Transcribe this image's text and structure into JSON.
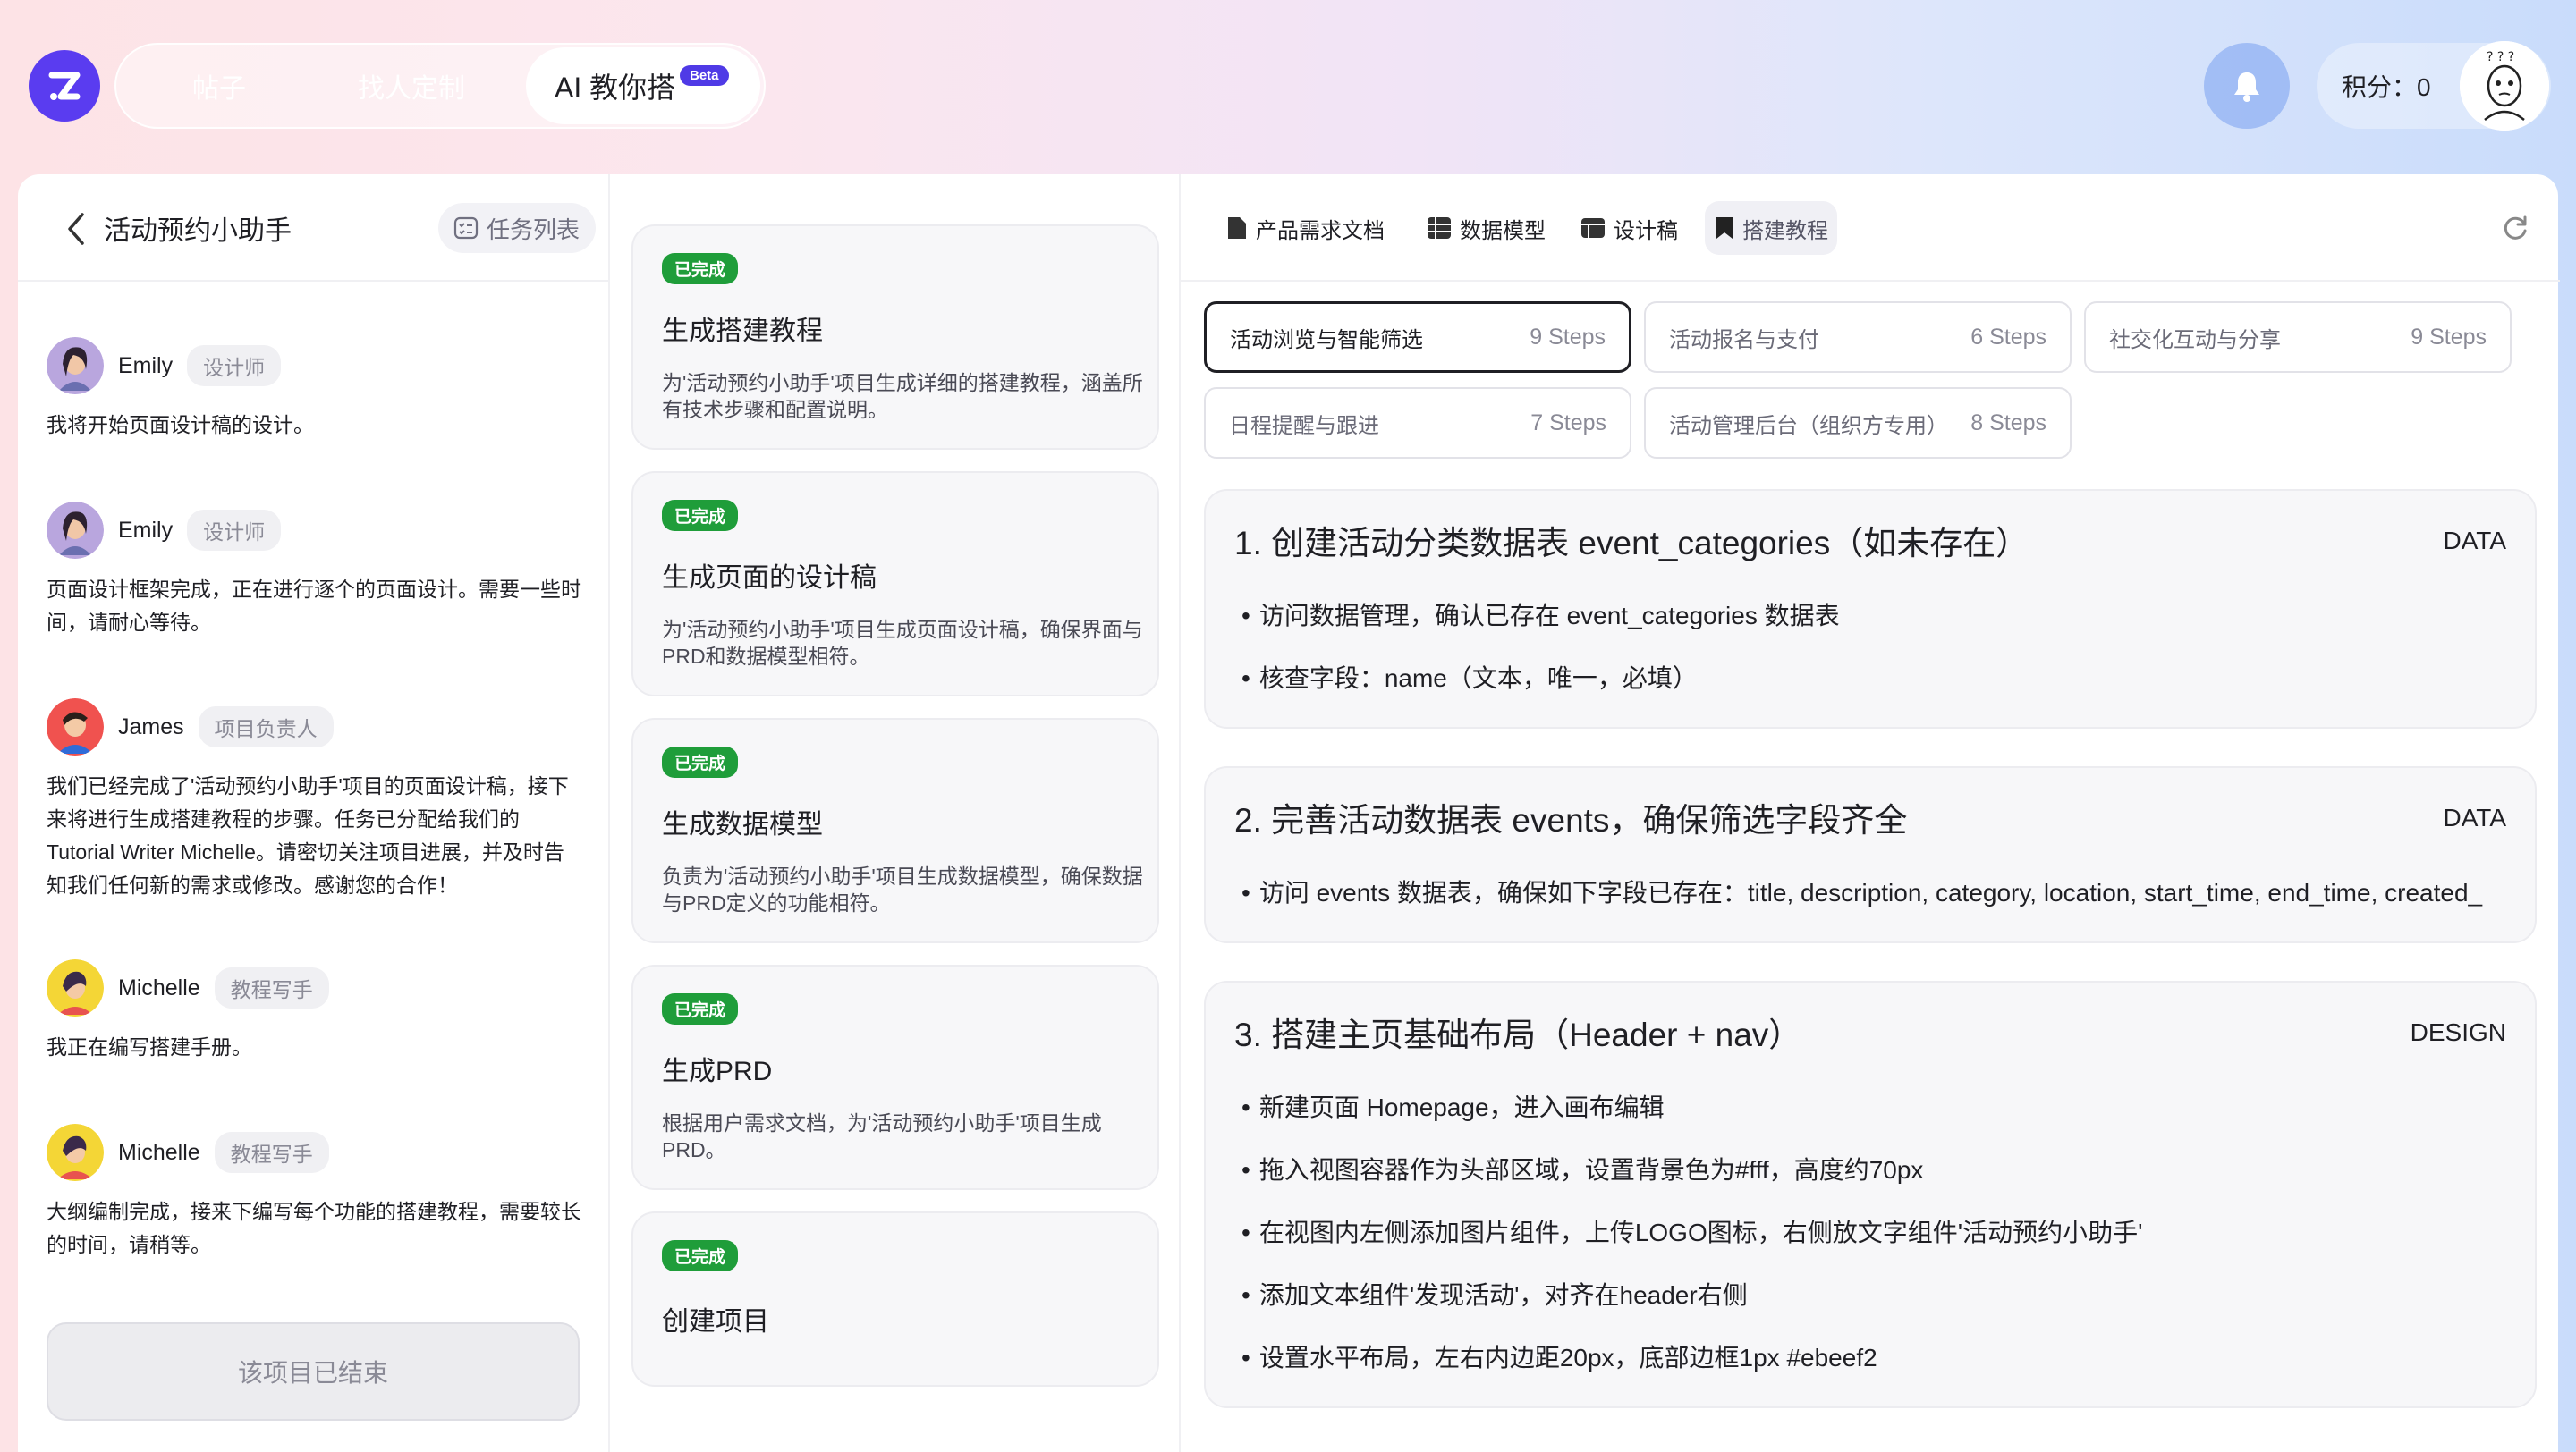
{
  "nav": {
    "tabs": [
      "帖子",
      "找人定制"
    ],
    "active_tab": "AI 教你搭",
    "beta": "Beta",
    "score_label": "积分：0"
  },
  "left": {
    "title": "活动预约小助手",
    "task_list": "任务列表",
    "messages": [
      {
        "name": "Emily",
        "role": "设计师",
        "text": "我将开始页面设计稿的设计。"
      },
      {
        "name": "Emily",
        "role": "设计师",
        "text": "页面设计框架完成，正在进行逐个的页面设计。需要一些时间，请耐心等待。"
      },
      {
        "name": "James",
        "role": "项目负责人",
        "text": "我们已经完成了'活动预约小助手'项目的页面设计稿，接下来将进行生成搭建教程的步骤。任务已分配给我们的Tutorial Writer Michelle。请密切关注项目进展，并及时告知我们任何新的需求或修改。感谢您的合作！"
      },
      {
        "name": "Michelle",
        "role": "教程写手",
        "text": "我正在编写搭建手册。"
      },
      {
        "name": "Michelle",
        "role": "教程写手",
        "text": "大纲编制完成，接来下编写每个功能的搭建教程，需要较长的时间，请稍等。"
      }
    ],
    "ended": "该项目已结束"
  },
  "mid": {
    "cards": [
      {
        "badge": "已完成",
        "title": "生成搭建教程",
        "desc": "为'活动预约小助手'项目生成详细的搭建教程，涵盖所有技术步骤和配置说明。"
      },
      {
        "badge": "已完成",
        "title": "生成页面的设计稿",
        "desc": "为'活动预约小助手'项目生成页面设计稿，确保界面与PRD和数据模型相符。"
      },
      {
        "badge": "已完成",
        "title": "生成数据模型",
        "desc": "负责为'活动预约小助手'项目生成数据模型，确保数据与PRD定义的功能相符。"
      },
      {
        "badge": "已完成",
        "title": "生成PRD",
        "desc": "根据用户需求文档，为'活动预约小助手'项目生成PRD。"
      },
      {
        "badge": "已完成",
        "title": "创建项目",
        "desc": ""
      }
    ]
  },
  "right": {
    "tabs": [
      "产品需求文档",
      "数据模型",
      "设计稿",
      "搭建教程"
    ],
    "chips": [
      {
        "label": "活动浏览与智能筛选",
        "steps": "9 Steps"
      },
      {
        "label": "活动报名与支付",
        "steps": "6 Steps"
      },
      {
        "label": "社交化互动与分享",
        "steps": "9 Steps"
      },
      {
        "label": "日程提醒与跟进",
        "steps": "7 Steps"
      },
      {
        "label": "活动管理后台（组织方专用）",
        "steps": "8 Steps"
      }
    ],
    "steps": [
      {
        "title": "1. 创建活动分类数据表 event_categories（如未存在）",
        "type": "DATA",
        "items": [
          "访问数据管理，确认已存在 event_categories 数据表",
          "核查字段：name（文本，唯一，必填）"
        ]
      },
      {
        "title": "2. 完善活动数据表 events，确保筛选字段齐全",
        "type": "DATA",
        "items": [
          "访问 events 数据表，确保如下字段已存在：title, description, category, location, start_time, end_time, created_"
        ]
      },
      {
        "title": "3. 搭建主页基础布局（Header + nav）",
        "type": "DESIGN",
        "items": [
          "新建页面 Homepage，进入画布编辑",
          "拖入视图容器作为头部区域，设置背景色为#fff，高度约70px",
          "在视图内左侧添加图片组件，上传LOGO图标，右侧放文字组件'活动预约小助手'",
          "添加文本组件'发现活动'，对齐在header右侧",
          "设置水平布局，左右内边距20px，底部边框1px #ebeef2"
        ]
      }
    ]
  }
}
